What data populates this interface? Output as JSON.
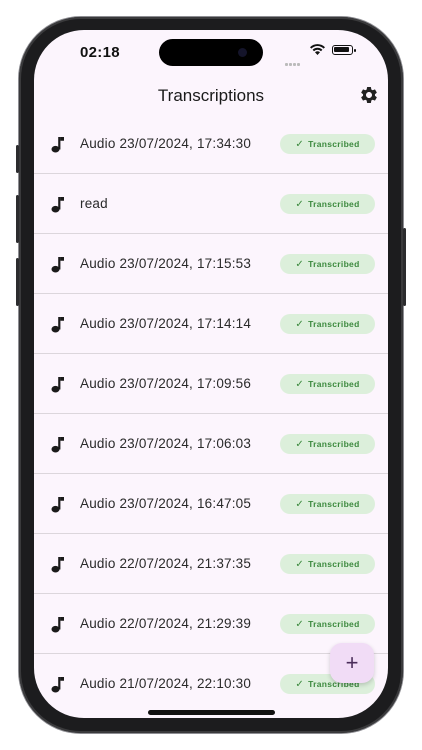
{
  "status_bar": {
    "time": "02:18"
  },
  "app_bar": {
    "title": "Transcriptions",
    "settings_icon": "gear-icon"
  },
  "items": [
    {
      "name": "Audio 23/07/2024, 17:34:30",
      "status": "Transcribed"
    },
    {
      "name": "read",
      "status": "Transcribed"
    },
    {
      "name": "Audio 23/07/2024, 17:15:53",
      "status": "Transcribed"
    },
    {
      "name": "Audio 23/07/2024, 17:14:14",
      "status": "Transcribed"
    },
    {
      "name": "Audio 23/07/2024, 17:09:56",
      "status": "Transcribed"
    },
    {
      "name": "Audio 23/07/2024, 17:06:03",
      "status": "Transcribed"
    },
    {
      "name": "Audio 23/07/2024, 16:47:05",
      "status": "Transcribed"
    },
    {
      "name": "Audio 22/07/2024, 21:37:35",
      "status": "Transcribed"
    },
    {
      "name": "Audio 22/07/2024, 21:29:39",
      "status": "Transcribed"
    },
    {
      "name": "Audio 21/07/2024, 22:10:30",
      "status": "Transcribed"
    }
  ],
  "fab": {
    "label": "+",
    "icon": "plus-icon"
  },
  "colors": {
    "background": "#fcf5fd",
    "badge_bg": "#dcefdb",
    "badge_text": "#3d8a3f",
    "fab_bg": "#f1dcf6"
  }
}
